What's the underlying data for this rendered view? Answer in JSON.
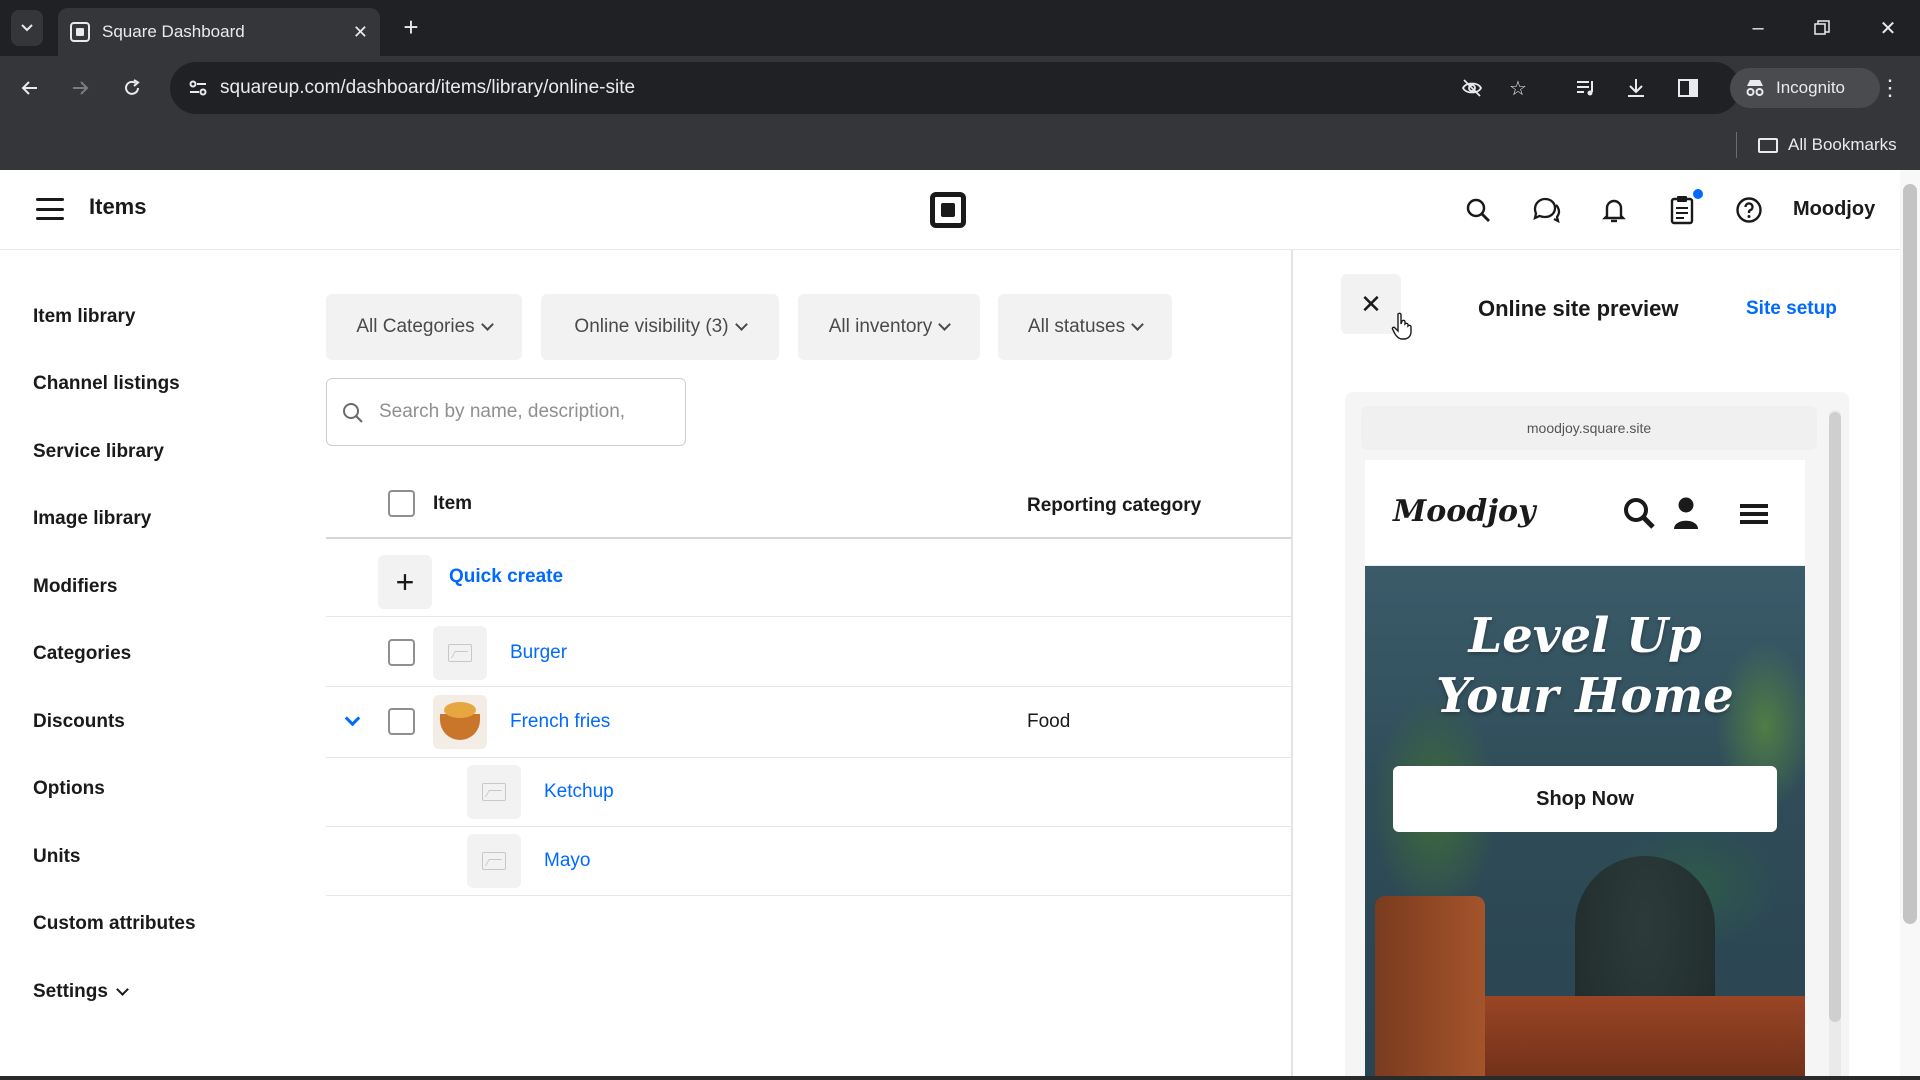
{
  "browser": {
    "tab_title": "Square Dashboard",
    "url": "squareup.com/dashboard/items/library/online-site",
    "profile_label": "Incognito",
    "bookmarks_label": "All Bookmarks"
  },
  "header": {
    "title": "Items",
    "user_name": "Moodjoy",
    "icons": [
      "search-icon",
      "messages-icon",
      "bell-icon",
      "clipboard-icon",
      "help-icon"
    ]
  },
  "sidebar": {
    "items": [
      {
        "label": "Item library"
      },
      {
        "label": "Channel listings"
      },
      {
        "label": "Service library"
      },
      {
        "label": "Image library"
      },
      {
        "label": "Modifiers"
      },
      {
        "label": "Categories"
      },
      {
        "label": "Discounts"
      },
      {
        "label": "Options"
      },
      {
        "label": "Units"
      },
      {
        "label": "Custom attributes"
      },
      {
        "label": "Settings"
      }
    ]
  },
  "filters": [
    {
      "label": "All Categories"
    },
    {
      "label": "Online visibility (3)"
    },
    {
      "label": "All inventory"
    },
    {
      "label": "All statuses"
    }
  ],
  "search": {
    "placeholder": "Search by name, description,"
  },
  "table": {
    "columns": [
      "Item",
      "Reporting category"
    ],
    "quick_create": "Quick create",
    "rows": [
      {
        "name": "Burger",
        "category": ""
      },
      {
        "name": "French fries",
        "category": "Food"
      },
      {
        "name": "Ketchup",
        "category": ""
      },
      {
        "name": "Mayo",
        "category": ""
      }
    ]
  },
  "preview": {
    "title": "Online site preview",
    "site_setup": "Site setup",
    "site_url": "moodjoy.square.site",
    "site_logo": "Moodjoy",
    "hero_line1": "Level Up",
    "hero_line2": "Your Home",
    "cta": "Shop Now"
  },
  "colors": {
    "accent": "#006aff",
    "text": "#1a1a1a",
    "chrome_dark": "#202124"
  }
}
